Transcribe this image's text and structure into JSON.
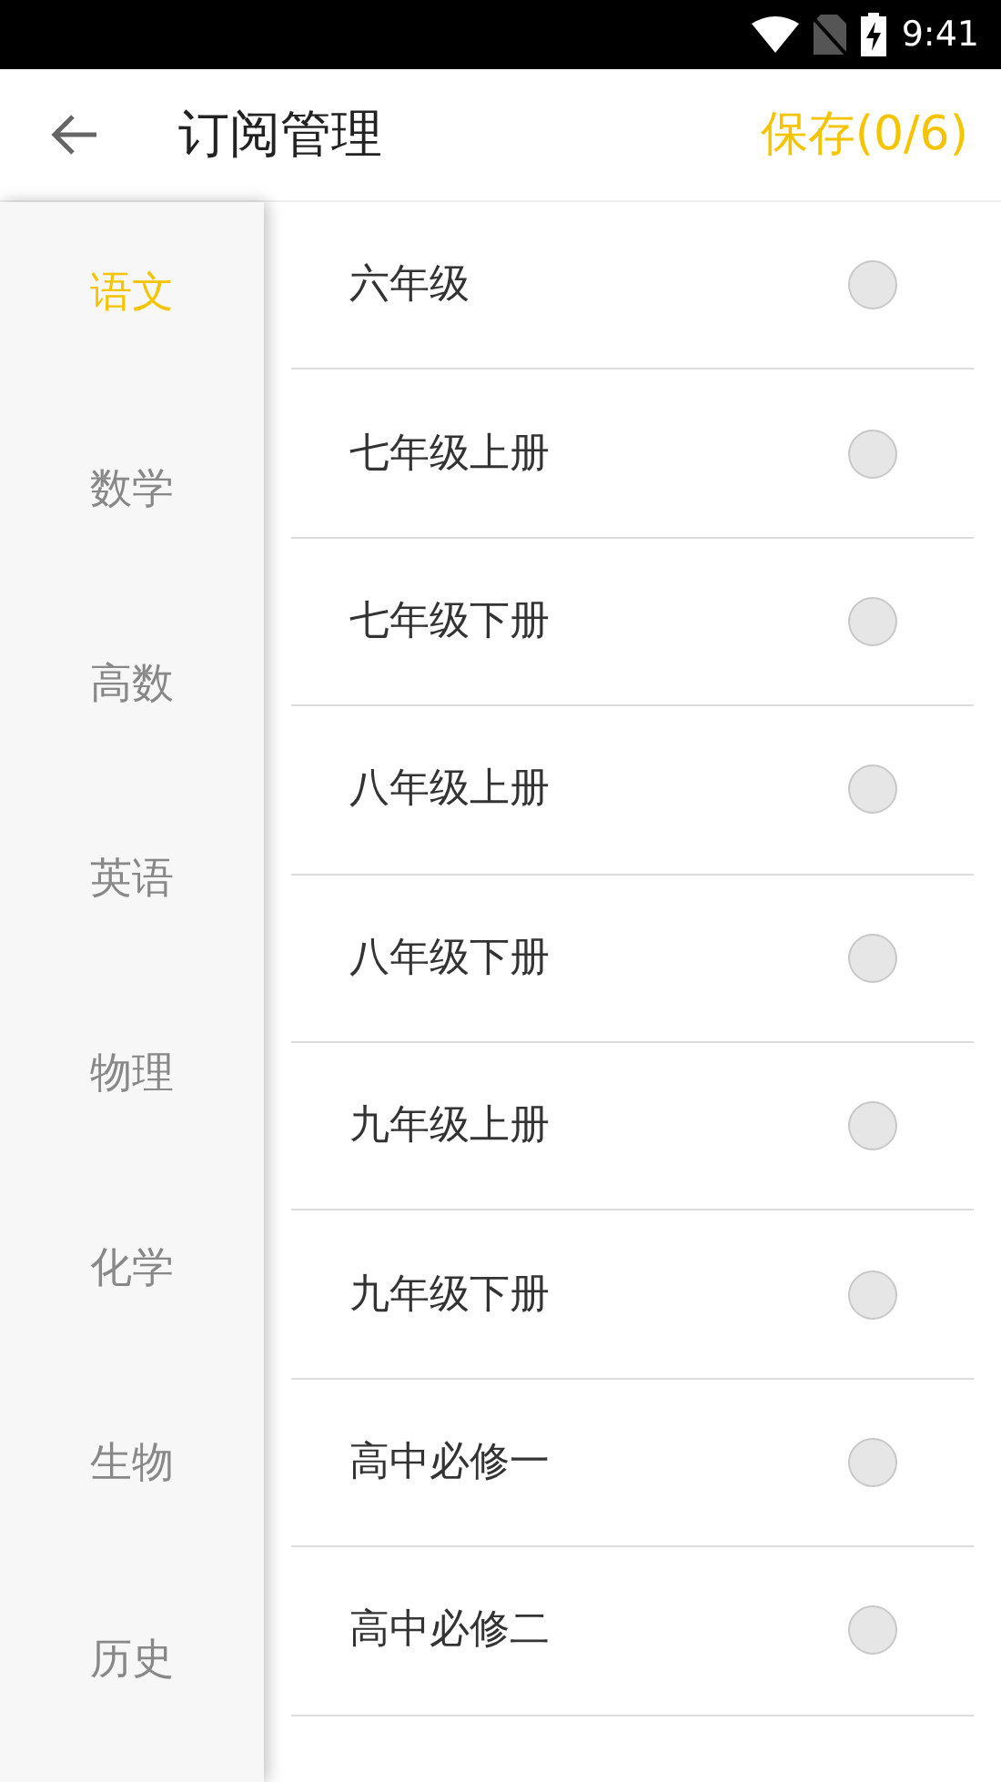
{
  "status_bar": {
    "time": "9:41"
  },
  "header": {
    "title": "订阅管理",
    "save_label": "保存(0/6)"
  },
  "sidebar": {
    "items": [
      {
        "label": "语文",
        "selected": true
      },
      {
        "label": "数学",
        "selected": false
      },
      {
        "label": "高数",
        "selected": false
      },
      {
        "label": "英语",
        "selected": false
      },
      {
        "label": "物理",
        "selected": false
      },
      {
        "label": "化学",
        "selected": false
      },
      {
        "label": "生物",
        "selected": false
      },
      {
        "label": "历史",
        "selected": false
      }
    ]
  },
  "books": [
    {
      "label": "六年级",
      "checked": false
    },
    {
      "label": "七年级上册",
      "checked": false
    },
    {
      "label": "七年级下册",
      "checked": false
    },
    {
      "label": "八年级上册",
      "checked": false
    },
    {
      "label": "八年级下册",
      "checked": false
    },
    {
      "label": "九年级上册",
      "checked": false
    },
    {
      "label": "九年级下册",
      "checked": false
    },
    {
      "label": "高中必修一",
      "checked": false
    },
    {
      "label": "高中必修二",
      "checked": false
    }
  ]
}
